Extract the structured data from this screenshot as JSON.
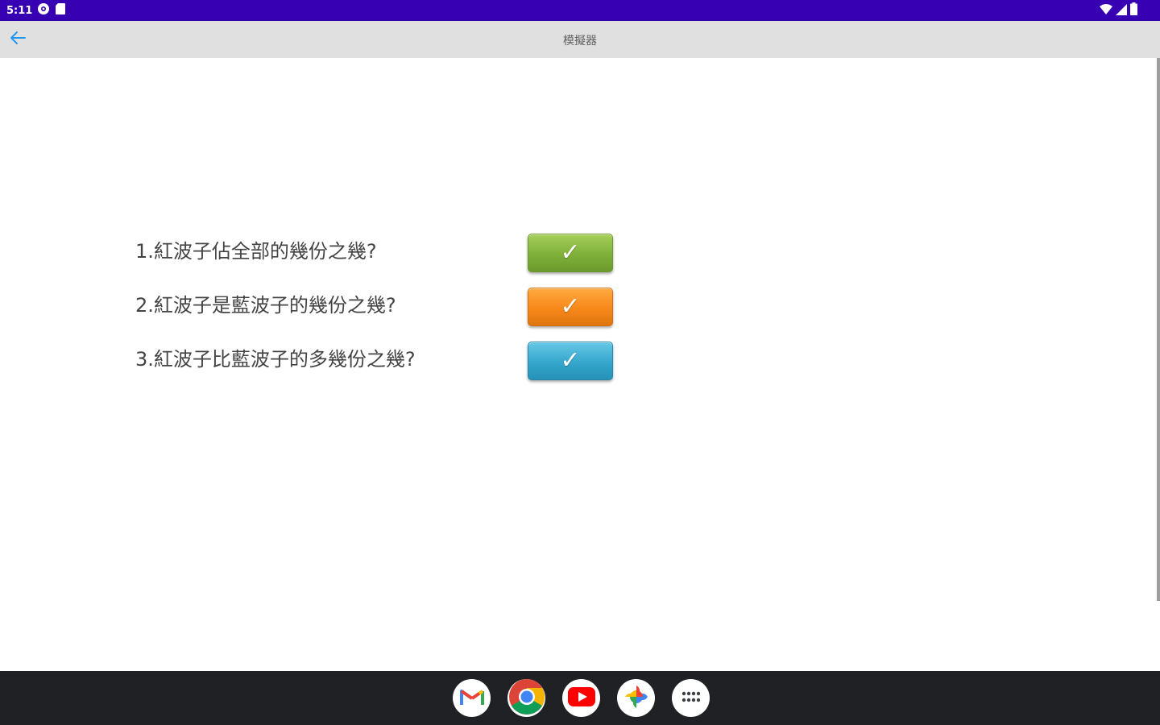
{
  "statusbar": {
    "time": "5:11",
    "colors": {
      "background": "#3700b3",
      "foreground": "#ffffff"
    },
    "icons": [
      "settings-status-icon",
      "sd-card-icon",
      "wifi-icon",
      "cellular-signal-icon",
      "battery-icon"
    ]
  },
  "appbar": {
    "title": "模擬器",
    "back_icon": "arrow-left-icon",
    "colors": {
      "background": "#e0e0e0",
      "accent": "#2196f3"
    }
  },
  "main": {
    "questions": [
      {
        "text": "1.紅波子佔全部的幾份之幾?",
        "button_symbol": "✓",
        "button_color": "#8bc34a"
      },
      {
        "text": "2.紅波子是藍波子的幾份之幾?",
        "button_symbol": "✓",
        "button_color": "#f7881a"
      },
      {
        "text": "3.紅波子比藍波子的多幾份之幾?",
        "button_symbol": "✓",
        "button_color": "#34a6cc"
      }
    ]
  },
  "taskbar": {
    "apps": [
      {
        "name": "Gmail",
        "icon": "gmail-icon"
      },
      {
        "name": "Chrome",
        "icon": "chrome-icon"
      },
      {
        "name": "YouTube",
        "icon": "youtube-icon"
      },
      {
        "name": "Photos",
        "icon": "photos-icon"
      },
      {
        "name": "Apps",
        "icon": "app-launcher-icon"
      }
    ],
    "colors": {
      "background": "#202124"
    }
  }
}
